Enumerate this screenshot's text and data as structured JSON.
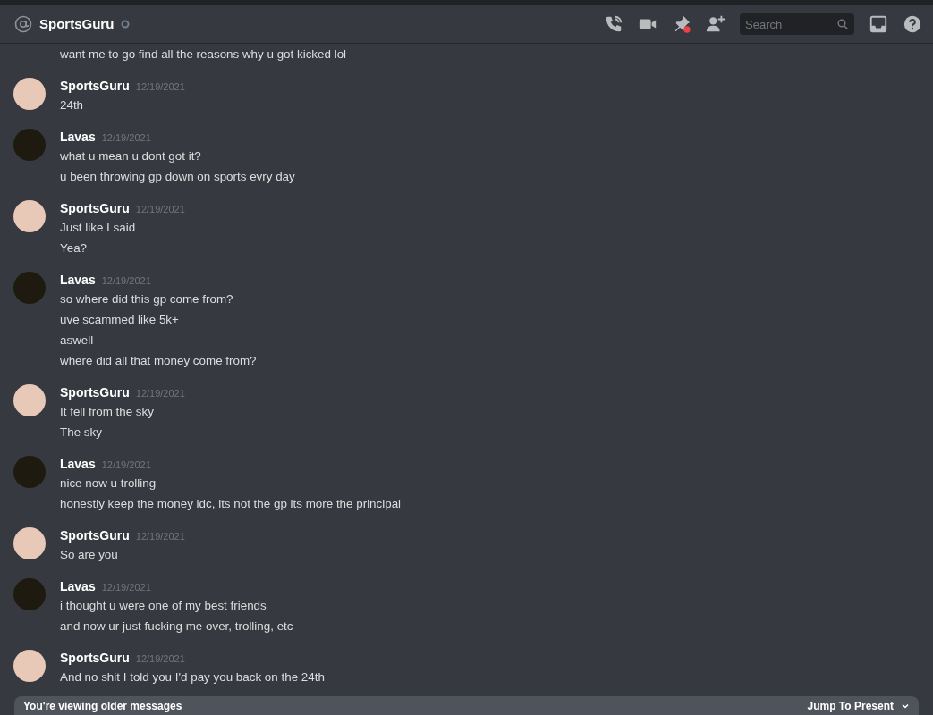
{
  "header": {
    "title": "SportsGuru",
    "search": {
      "placeholder": "Search"
    }
  },
  "messages": [
    {
      "kind": "cont",
      "lines": [
        "want me to go find all the reasons why u got kicked lol"
      ]
    },
    {
      "author": "SportsGuru",
      "time": "12/19/2021",
      "kind": "group",
      "lines": [
        "24th"
      ]
    },
    {
      "author": "Lavas",
      "time": "12/19/2021",
      "kind": "group",
      "lines": [
        "what u mean u dont got it?",
        "u been throwing gp down on sports evry day"
      ]
    },
    {
      "author": "SportsGuru",
      "time": "12/19/2021",
      "kind": "group",
      "lines": [
        "Just like I said",
        "Yea?"
      ]
    },
    {
      "author": "Lavas",
      "time": "12/19/2021",
      "kind": "group",
      "lines": [
        "so where did this gp come from?",
        "uve scammed like 5k+",
        "aswell",
        "where did all that money come from?"
      ]
    },
    {
      "author": "SportsGuru",
      "time": "12/19/2021",
      "kind": "group",
      "lines": [
        "It fell from the sky",
        "The sky"
      ]
    },
    {
      "author": "Lavas",
      "time": "12/19/2021",
      "kind": "group",
      "lines": [
        "nice now u trolling",
        "honestly keep the money idc, its not the gp its more the principal"
      ]
    },
    {
      "author": "SportsGuru",
      "time": "12/19/2021",
      "kind": "group",
      "lines": [
        "So are you"
      ]
    },
    {
      "author": "Lavas",
      "time": "12/19/2021",
      "kind": "group",
      "lines": [
        "i thought u were one of my best friends",
        "and now ur just fucking me over, trolling, etc"
      ]
    },
    {
      "author": "SportsGuru",
      "time": "12/19/2021",
      "kind": "group",
      "lines": [
        "And no shit I told you I'd pay you back on the 24th"
      ]
    }
  ],
  "older_bar": {
    "text": "You're viewing older messages",
    "action": "Jump To Present"
  }
}
